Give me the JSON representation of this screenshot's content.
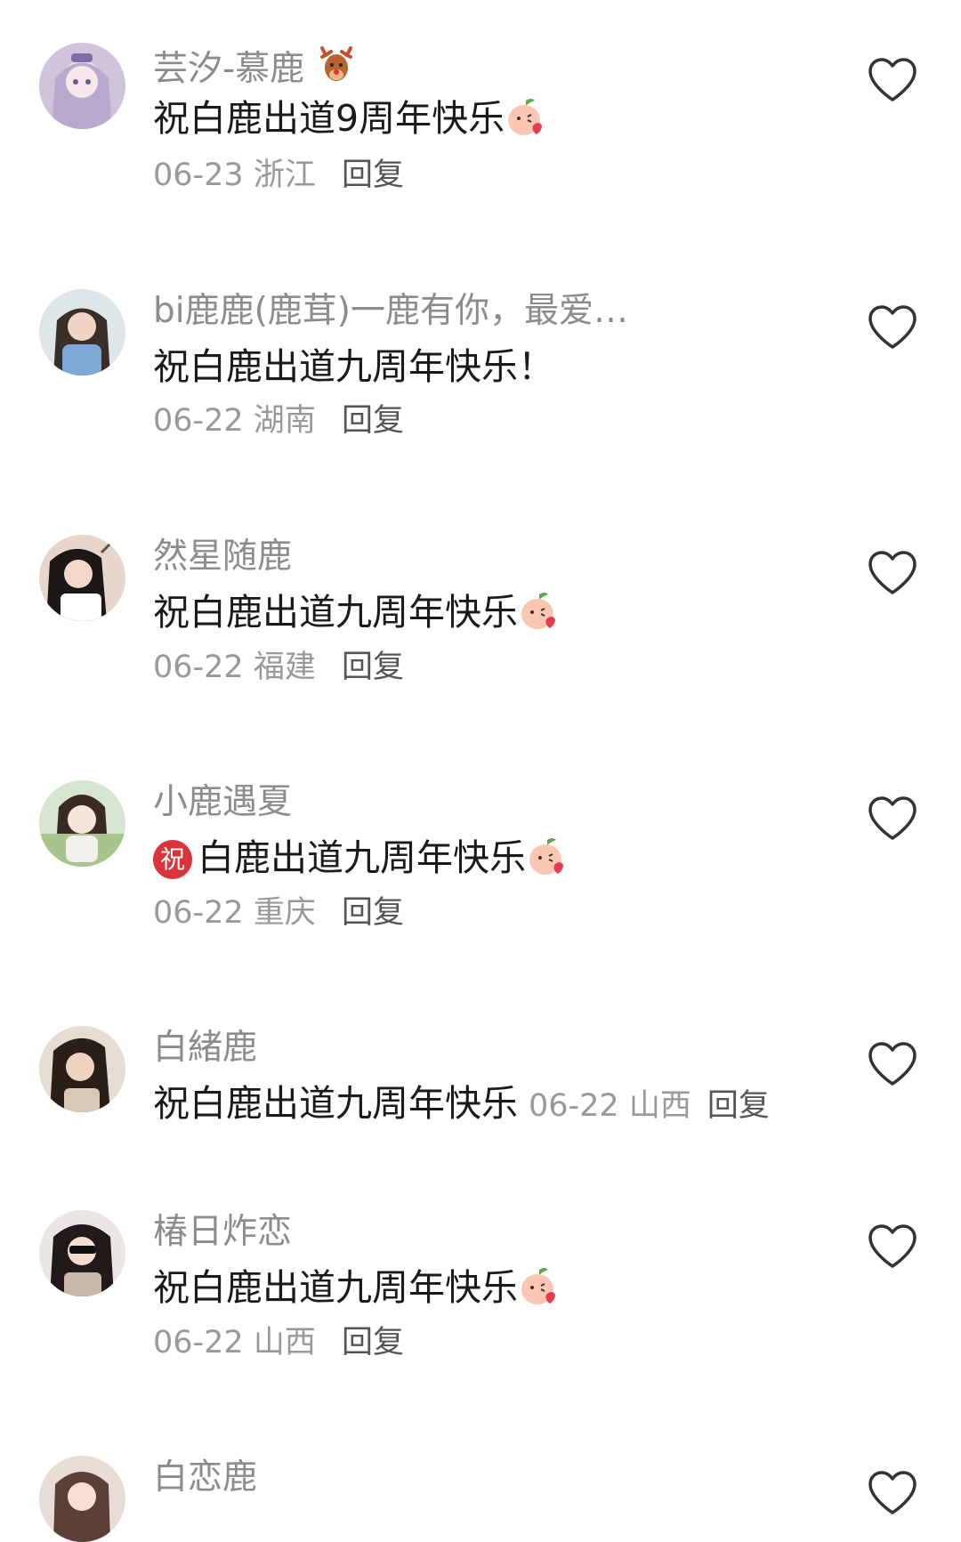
{
  "comments": [
    {
      "username": "芸汐-慕鹿",
      "text": "祝白鹿出道9周年快乐",
      "date": "06-23",
      "location": "浙江",
      "reply": "回复"
    },
    {
      "username": "bi鹿鹿(鹿茸)一鹿有你，最爱…",
      "text": "祝白鹿出道九周年快乐！",
      "date": "06-22",
      "location": "湖南",
      "reply": "回复"
    },
    {
      "username": "然星随鹿",
      "text": "祝白鹿出道九周年快乐",
      "date": "06-22",
      "location": "福建",
      "reply": "回复"
    },
    {
      "username": "小鹿遇夏",
      "badge": "祝",
      "text": "白鹿出道九周年快乐",
      "date": "06-22",
      "location": "重庆",
      "reply": "回复"
    },
    {
      "username": "白緒鹿",
      "text": "祝白鹿出道九周年快乐",
      "date": "06-22",
      "location": "山西",
      "reply": "回复"
    },
    {
      "username": "椿日炸恋",
      "text": "祝白鹿出道九周年快乐",
      "date": "06-22",
      "location": "山西",
      "reply": "回复"
    },
    {
      "username": "白恋鹿"
    }
  ],
  "icons": {
    "like": "heart-outline-icon",
    "username_emoji": "deer-emoji",
    "text_emoji": "peach-kiss-emoji"
  },
  "colors": {
    "username": "#8c8c8c",
    "text": "#1a1a1a",
    "meta": "#999999",
    "reply": "#555555",
    "badge": "#d8343a"
  }
}
